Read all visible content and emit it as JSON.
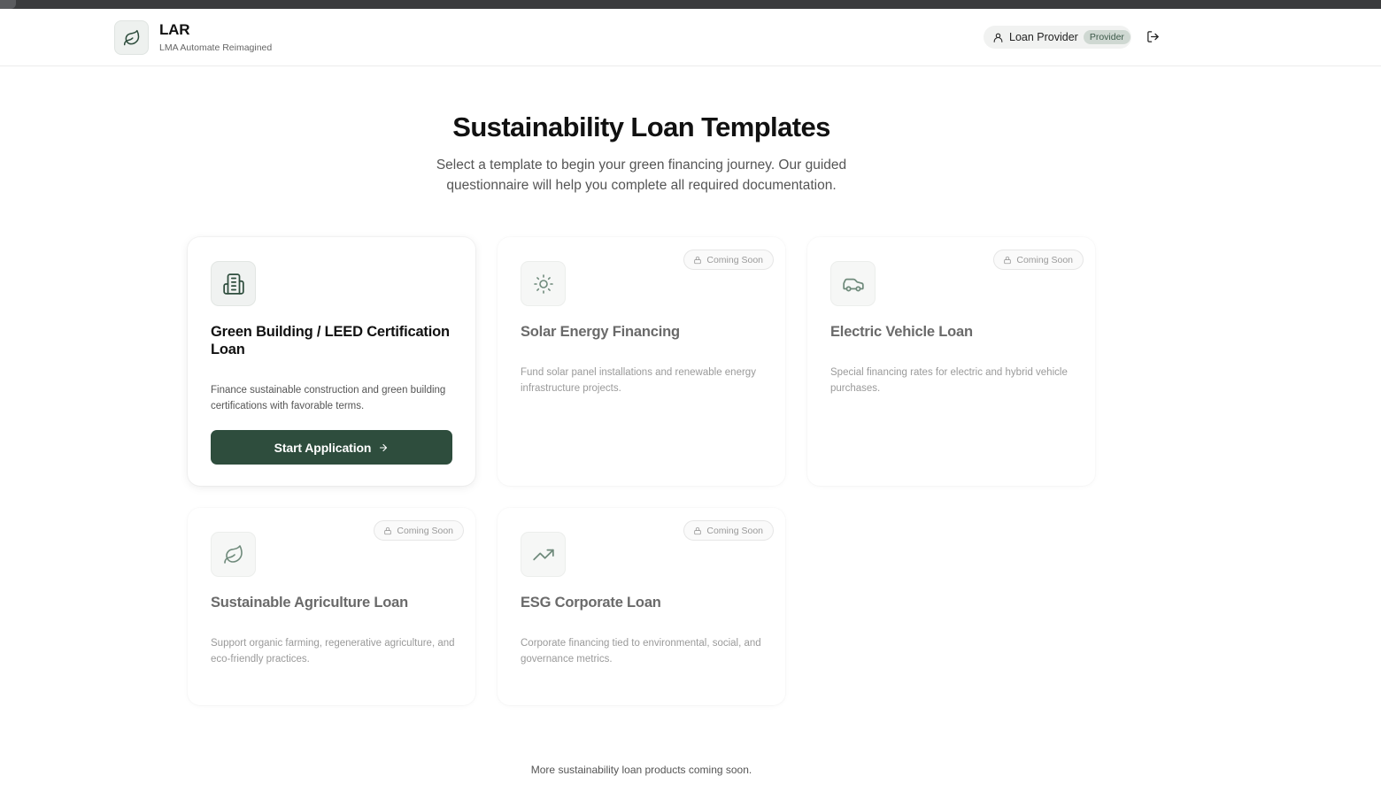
{
  "app": {
    "name": "LAR",
    "subtitle": "LMA Automate Reimagined",
    "logo_icon": "leaf-icon"
  },
  "user": {
    "name": "Loan Provider",
    "role": "Provider",
    "user_icon": "user-icon",
    "logout_icon": "logout-icon"
  },
  "page": {
    "title": "Sustainability Loan Templates",
    "subtitle": "Select a template to begin your green financing journey. Our guided questionnaire will help you complete all required documentation.",
    "footer_note": "More sustainability loan products coming soon."
  },
  "templates": [
    {
      "title": "Green Building / LEED Certification Loan",
      "description": "Finance sustainable construction and green building certifications with favorable terms.",
      "icon": "building-icon",
      "status": "available",
      "button_label": "Start Application"
    },
    {
      "title": "Solar Energy Financing",
      "description": "Fund solar panel installations and renewable energy infrastructure projects.",
      "icon": "sun-icon",
      "status": "coming-soon",
      "badge": "Coming Soon"
    },
    {
      "title": "Electric Vehicle Loan",
      "description": "Special financing rates for electric and hybrid vehicle purchases.",
      "icon": "car-icon",
      "status": "coming-soon",
      "badge": "Coming Soon"
    },
    {
      "title": "Sustainable Agriculture Loan",
      "description": "Support organic farming, regenerative agriculture, and eco-friendly practices.",
      "icon": "leaf-icon",
      "status": "coming-soon",
      "badge": "Coming Soon"
    },
    {
      "title": "ESG Corporate Loan",
      "description": "Corporate financing tied to environmental, social, and governance metrics.",
      "icon": "trending-up-icon",
      "status": "coming-soon",
      "badge": "Coming Soon"
    }
  ],
  "colors": {
    "primary": "#2e4d3d",
    "badge_bg": "#cfd8d2",
    "muted_text": "#9a9a9a"
  }
}
